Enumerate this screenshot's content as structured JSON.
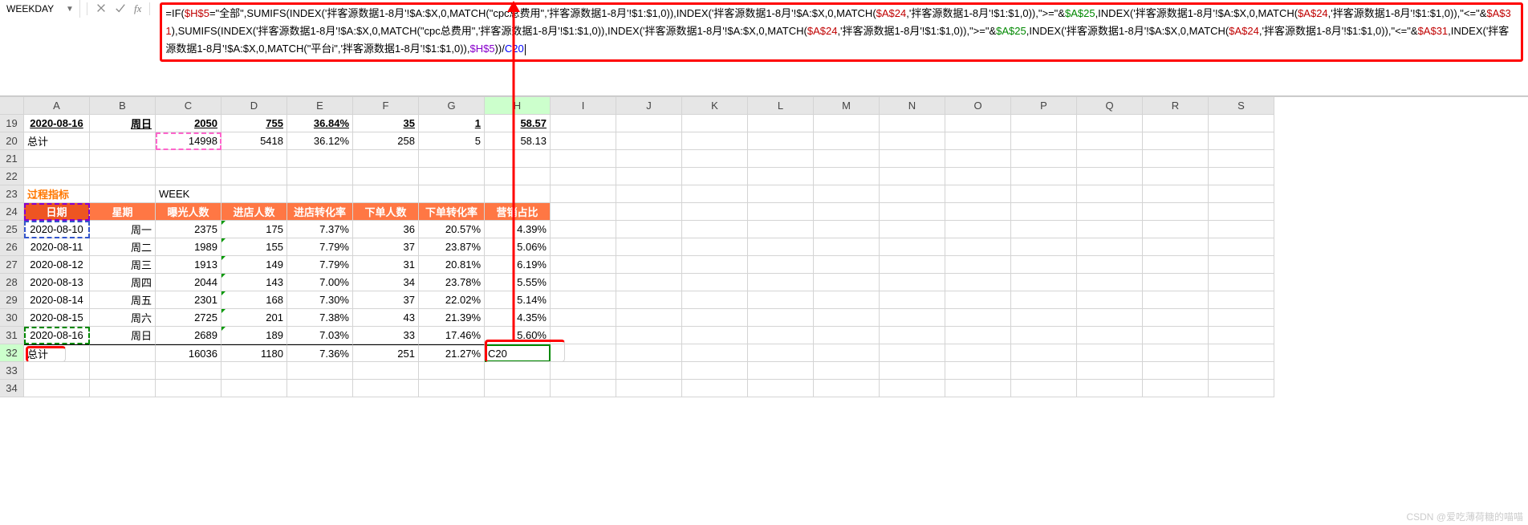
{
  "formula_bar": {
    "namebox_value": "WEEKDAY",
    "fx_label": "fx",
    "formula_html": "=IF(<span class='c-red'>$H$5</span>=\"全部\",SUMIFS(INDEX('拌客源数据1-8月'!$A:$X,0,MATCH(\"cpc总费用\",'拌客源数据1-8月'!$1:$1,0)),INDEX('拌客源数据1-8月'!$A:$X,0,MATCH(<span class='c-red'>$A$24</span>,'拌客源数据1-8月'!$1:$1,0)),\"&gt;=\"&amp;<span class='c-green'>$A$25</span>,INDEX('拌客源数据1-8月'!$A:$X,0,MATCH(<span class='c-red'>$A$24</span>,'拌客源数据1-8月'!$1:$1,0)),\"&lt;=\"&amp;<span class='c-red'>$A$31</span>),SUMIFS(INDEX('拌客源数据1-8月'!$A:$X,0,MATCH(\"cpc总费用\",'拌客源数据1-8月'!$1:$1,0)),INDEX('拌客源数据1-8月'!$A:$X,0,MATCH(<span class='c-red'>$A$24</span>,'拌客源数据1-8月'!$1:$1,0)),\"&gt;=\"&amp;<span class='c-green'>$A$25</span>,INDEX('拌客源数据1-8月'!$A:$X,0,MATCH(<span class='c-red'>$A$24</span>,'拌客源数据1-8月'!$1:$1,0)),\"&lt;=\"&amp;<span class='c-red'>$A$31</span>,INDEX('拌客源数据1-8月'!$A:$X,0,MATCH(\"平台i\",'拌客源数据1-8月'!$1:$1,0)),<span class='c-purple'>$H$5</span>))/<span class='c-blue'>C20</span><span class='cursor'></span>"
  },
  "columns": [
    "A",
    "B",
    "C",
    "D",
    "E",
    "F",
    "G",
    "H",
    "I",
    "J",
    "K",
    "L",
    "M",
    "N",
    "O",
    "P",
    "Q",
    "R",
    "S"
  ],
  "rows": [
    "19",
    "20",
    "21",
    "22",
    "23",
    "24",
    "25",
    "26",
    "27",
    "28",
    "29",
    "30",
    "31",
    "32",
    "33",
    "34"
  ],
  "active_col": "H",
  "active_row": "32",
  "h19": {
    "a": "2020-08-16",
    "b": "周日",
    "c": "2050",
    "d": "755",
    "e": "36.84%",
    "f": "35",
    "g": "1",
    "h": "58.57"
  },
  "h20": {
    "a": "总计",
    "c": "14998",
    "d": "5418",
    "e": "36.12%",
    "f": "258",
    "g": "5",
    "h": "58.13"
  },
  "h23": {
    "a": "过程指标",
    "c": "WEEK"
  },
  "headers": {
    "a": "日期",
    "b": "星期",
    "c": "曝光人数",
    "d": "进店人数",
    "e": "进店转化率",
    "f": "下单人数",
    "g": "下单转化率",
    "h": "营销占比"
  },
  "t": [
    {
      "a": "2020-08-10",
      "b": "周一",
      "c": "2375",
      "d": "175",
      "e": "7.37%",
      "f": "36",
      "g": "20.57%",
      "h": "4.39%"
    },
    {
      "a": "2020-08-11",
      "b": "周二",
      "c": "1989",
      "d": "155",
      "e": "7.79%",
      "f": "37",
      "g": "23.87%",
      "h": "5.06%"
    },
    {
      "a": "2020-08-12",
      "b": "周三",
      "c": "1913",
      "d": "149",
      "e": "7.79%",
      "f": "31",
      "g": "20.81%",
      "h": "6.19%"
    },
    {
      "a": "2020-08-13",
      "b": "周四",
      "c": "2044",
      "d": "143",
      "e": "7.00%",
      "f": "34",
      "g": "23.78%",
      "h": "5.55%"
    },
    {
      "a": "2020-08-14",
      "b": "周五",
      "c": "2301",
      "d": "168",
      "e": "7.30%",
      "f": "37",
      "g": "22.02%",
      "h": "5.14%"
    },
    {
      "a": "2020-08-15",
      "b": "周六",
      "c": "2725",
      "d": "201",
      "e": "7.38%",
      "f": "43",
      "g": "21.39%",
      "h": "4.35%"
    },
    {
      "a": "2020-08-16",
      "b": "周日",
      "c": "2689",
      "d": "189",
      "e": "7.03%",
      "f": "33",
      "g": "17.46%",
      "h": "5.60%"
    }
  ],
  "total": {
    "a": "总计",
    "c": "16036",
    "d": "1180",
    "e": "7.36%",
    "f": "251",
    "g": "21.27%",
    "h": "C20"
  },
  "watermark": "CSDN @爱吃薄荷糖的喵喵"
}
